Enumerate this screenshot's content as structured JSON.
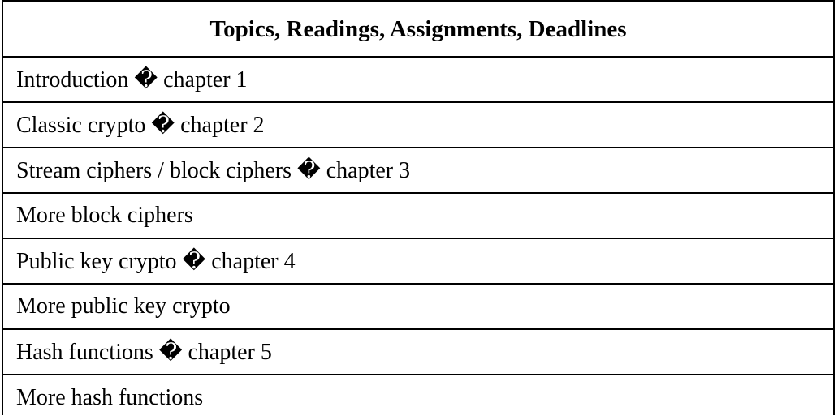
{
  "table": {
    "header": "Topics, Readings, Assignments, Deadlines",
    "rows": [
      "Introduction � chapter 1",
      "Classic crypto � chapter 2",
      "Stream ciphers / block ciphers � chapter 3",
      "More block ciphers",
      "Public key crypto � chapter 4",
      "More public key crypto",
      "Hash functions � chapter 5",
      "More hash functions"
    ]
  }
}
